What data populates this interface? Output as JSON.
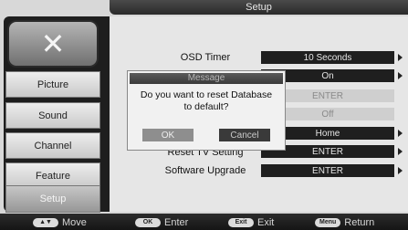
{
  "header": {
    "title": "Setup"
  },
  "sidebar": {
    "items": [
      {
        "label": "Picture"
      },
      {
        "label": "Sound"
      },
      {
        "label": "Channel"
      },
      {
        "label": "Feature"
      },
      {
        "label": "Setup"
      }
    ]
  },
  "settings": [
    {
      "label": "OSD Timer",
      "value": "10 Seconds"
    },
    {
      "label": "",
      "value": "On"
    },
    {
      "label": "",
      "value": "ENTER"
    },
    {
      "label": "",
      "value": "Off"
    },
    {
      "label": "",
      "value": "Home"
    },
    {
      "label": "Reset TV Setting",
      "value": "ENTER"
    },
    {
      "label": "Software Upgrade",
      "value": "ENTER"
    }
  ],
  "dialog": {
    "title": "Message",
    "text_line1": "Do you want to reset Database",
    "text_line2": "to default?",
    "ok": "OK",
    "cancel": "Cancel"
  },
  "footer": {
    "move_key": "▲▼",
    "move": "Move",
    "enter_key": "OK",
    "enter": "Enter",
    "exit_key": "Exit",
    "exit": "Exit",
    "return_key": "Menu",
    "return": "Return"
  }
}
